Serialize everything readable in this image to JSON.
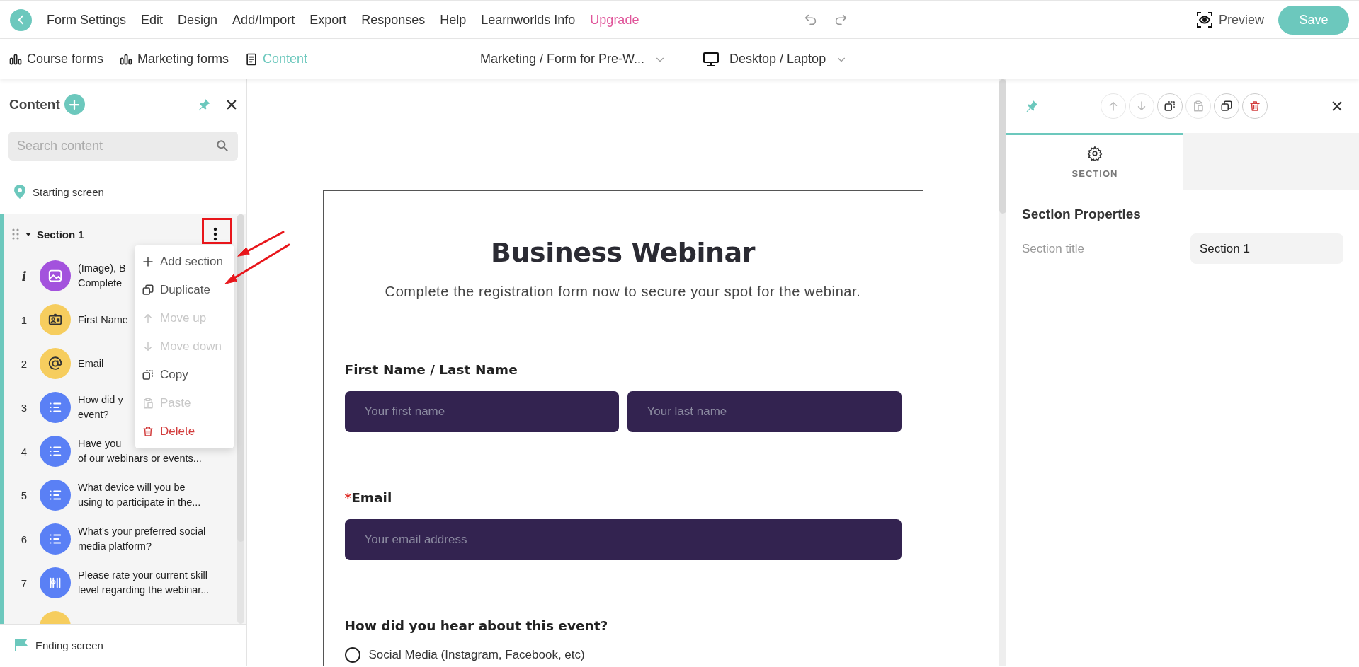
{
  "menu_bar": {
    "items": [
      {
        "label": "Form Settings",
        "kind": "normal"
      },
      {
        "label": "Edit",
        "kind": "normal"
      },
      {
        "label": "Design",
        "kind": "normal"
      },
      {
        "label": "Add/Import",
        "kind": "normal"
      },
      {
        "label": "Export",
        "kind": "normal"
      },
      {
        "label": "Responses",
        "kind": "normal"
      },
      {
        "label": "Help",
        "kind": "normal"
      },
      {
        "label": "Learnworlds Info",
        "kind": "normal"
      },
      {
        "label": "Upgrade",
        "kind": "upgrade"
      }
    ]
  },
  "toolbar": {
    "preview": "Preview",
    "save": "Save"
  },
  "view_tabs": [
    {
      "label": "Course forms",
      "selected": false
    },
    {
      "label": "Marketing forms",
      "selected": false
    },
    {
      "label": "Content",
      "selected": true
    }
  ],
  "form_select": "Marketing / Form for Pre-W...",
  "device_select": "Desktop / Laptop",
  "sidebar": {
    "title": "Content",
    "search_placeholder": "Search content",
    "starting_screen": "Starting screen",
    "section": {
      "title": "Section 1",
      "expanded": true,
      "items": [
        {
          "number": "i",
          "kind": "image",
          "lines": [
            "(Image), B",
            "Complete"
          ]
        },
        {
          "number": "1",
          "kind": "name",
          "lines": [
            "First Name"
          ]
        },
        {
          "number": "2",
          "kind": "email",
          "lines": [
            "Email"
          ]
        },
        {
          "number": "3",
          "kind": "choice",
          "lines": [
            "How did y",
            "event?"
          ]
        },
        {
          "number": "4",
          "kind": "choice",
          "lines": [
            "Have you",
            "of our webinars or events..."
          ]
        },
        {
          "number": "5",
          "kind": "choice",
          "lines": [
            "What device will you be",
            "using to participate in the..."
          ]
        },
        {
          "number": "6",
          "kind": "choice",
          "lines": [
            "What’s your preferred social",
            "media platform?"
          ]
        },
        {
          "number": "7",
          "kind": "scale",
          "lines": [
            "Please rate your current skill",
            "level regarding the webinar..."
          ]
        }
      ]
    },
    "ending_screen": "Ending screen"
  },
  "context_menu": [
    {
      "label": "Add section",
      "disabled": false,
      "kind": "normal"
    },
    {
      "label": "Duplicate",
      "disabled": false,
      "kind": "normal"
    },
    {
      "label": "Move up",
      "disabled": true,
      "kind": "normal"
    },
    {
      "label": "Move down",
      "disabled": true,
      "kind": "normal"
    },
    {
      "label": "Copy",
      "disabled": false,
      "kind": "normal"
    },
    {
      "label": "Paste",
      "disabled": true,
      "kind": "normal"
    },
    {
      "label": "Delete",
      "disabled": false,
      "kind": "danger"
    }
  ],
  "form": {
    "title": "Business Webinar",
    "subtitle": "Complete the registration form now to secure your spot for the webinar.",
    "questions": [
      {
        "kind": "name",
        "label": "First Name / Last Name",
        "placeholders": [
          "Your first name",
          "Your last name"
        ]
      },
      {
        "kind": "email",
        "label": "Email",
        "required_mark": "*",
        "placeholders": [
          "Your email address"
        ]
      },
      {
        "kind": "choice",
        "label": "How did you hear about this event?",
        "options": [
          {
            "label": "Social Media (Instagram, Facebook, etc)",
            "selected": false
          }
        ]
      }
    ]
  },
  "properties": {
    "actions": [
      {
        "disabled": true,
        "kind": "normal"
      },
      {
        "disabled": true,
        "kind": "normal"
      },
      {
        "disabled": false,
        "kind": "normal"
      },
      {
        "disabled": true,
        "kind": "normal"
      },
      {
        "disabled": false,
        "kind": "normal"
      },
      {
        "disabled": false,
        "kind": "danger"
      }
    ],
    "tabs": [
      {
        "label": "SECTION",
        "selected": true
      }
    ],
    "heading": "Section Properties",
    "fields": [
      {
        "label": "Section title",
        "value": "Section 1"
      }
    ]
  }
}
